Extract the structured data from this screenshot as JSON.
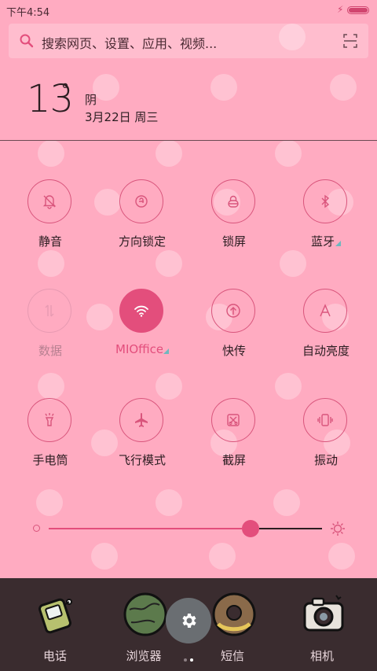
{
  "status": {
    "time": "下午4:54",
    "battery_level": 1.0
  },
  "search": {
    "placeholder": "搜索网页、设置、应用、视频..."
  },
  "weather": {
    "temp": "13",
    "degree": "°",
    "condition": "阴",
    "date": "3月22日 周三"
  },
  "toggles": [
    {
      "label": "静音",
      "icon": "bell-mute-icon",
      "state": "off"
    },
    {
      "label": "方向锁定",
      "icon": "rotation-lock-icon",
      "state": "off"
    },
    {
      "label": "锁屏",
      "icon": "lock-icon",
      "state": "off"
    },
    {
      "label": "蓝牙",
      "icon": "bluetooth-icon",
      "state": "off",
      "has_more": true
    },
    {
      "label": "数据",
      "icon": "mobile-data-icon",
      "state": "disabled"
    },
    {
      "label": "MIOffice",
      "icon": "wifi-icon",
      "state": "on",
      "has_more": true
    },
    {
      "label": "快传",
      "icon": "share-transfer-icon",
      "state": "off"
    },
    {
      "label": "自动亮度",
      "icon": "auto-brightness-icon",
      "state": "off"
    },
    {
      "label": "手电筒",
      "icon": "flashlight-icon",
      "state": "off"
    },
    {
      "label": "飞行模式",
      "icon": "airplane-icon",
      "state": "off"
    },
    {
      "label": "截屏",
      "icon": "screenshot-icon",
      "state": "off"
    },
    {
      "label": "振动",
      "icon": "vibrate-icon",
      "state": "off"
    }
  ],
  "brightness": {
    "level": 0.67
  },
  "dock": [
    {
      "label": "电话",
      "icon": "phone-app-icon"
    },
    {
      "label": "浏览器",
      "icon": "browser-app-icon"
    },
    {
      "label": "短信",
      "icon": "messages-app-icon"
    },
    {
      "label": "相机",
      "icon": "camera-app-icon"
    }
  ],
  "pager": {
    "pages": 2,
    "current": 2
  },
  "colors": {
    "background": "#ffabc1",
    "accent": "#e34e7c",
    "dock": "#3a2c2f"
  }
}
